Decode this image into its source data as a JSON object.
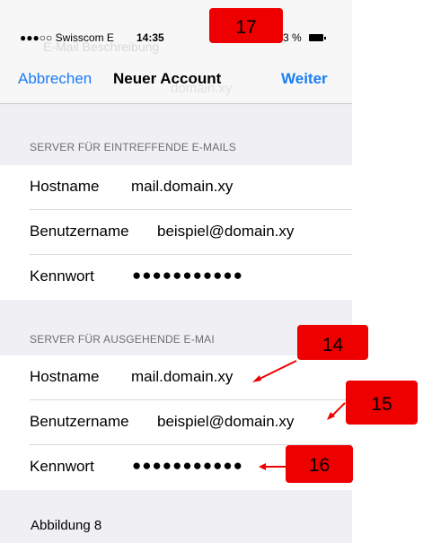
{
  "status_bar": {
    "carrier": "●●●○○ Swisscom  E",
    "time": "14:35",
    "battery": "3 %"
  },
  "nav": {
    "cancel_label": "Abbrechen",
    "title": "Neuer Account",
    "next_label": "Weiter",
    "ghost_top": "E-Mail            Beschreibung",
    "ghost_bottom": "domain.xy"
  },
  "incoming": {
    "header": "SERVER FÜR EINTREFFENDE E-MAILS",
    "hostname_label": "Hostname",
    "hostname_value": "mail.domain.xy",
    "username_label": "Benutzername",
    "username_value": "beispiel@domain.xy",
    "password_label": "Kennwort",
    "password_value": "●●●●●●●●●●●"
  },
  "outgoing": {
    "header": "SERVER FÜR AUSGEHENDE E-MAI",
    "hostname_label": "Hostname",
    "hostname_value": "mail.domain.xy",
    "username_label": "Benutzername",
    "username_value": "beispiel@domain.xy",
    "password_label": "Kennwort",
    "password_value": "●●●●●●●●●●●"
  },
  "annotations": {
    "a17": "17",
    "a14": "14",
    "a15": "15",
    "a16": "16",
    "color": "#ee0000"
  },
  "caption": "Abbildung 8"
}
